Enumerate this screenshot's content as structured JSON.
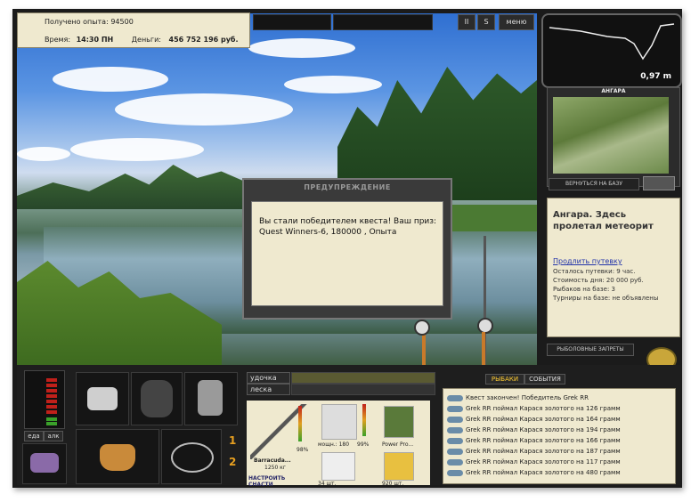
{
  "hud": {
    "exp_label": "Получено опыта:",
    "exp_value": "94500",
    "time_label": "Время:",
    "time_value": "14:30 ПН",
    "money_label": "Деньги:",
    "money_value": "456 752 196 руб."
  },
  "top": {
    "pause": "II",
    "speed": "S",
    "menu": "меню"
  },
  "depth": {
    "value": "0,97 m"
  },
  "map": {
    "title": "АНГАРА",
    "back_button": "ВЕРНУТЬСЯ НА БАЗУ"
  },
  "location": {
    "heading": "Ангара. Здесь пролетал метеорит",
    "extend_link": "Продлить путевку",
    "lines": [
      "Осталось путевки: 9 час.",
      "Стоимость дня: 20 000 руб.",
      "Рыбаков на базе: 3",
      "Турниры на базе: не объявлены"
    ],
    "bans_button": "РЫБОЛОВНЫЕ ЗАПРЕТЫ"
  },
  "dialog": {
    "title": "ПРЕДУПРЕЖДЕНИЕ",
    "message": "Вы стали победителем квеста! Ваш приз: Quest Winners-6, 180000 , Опыта"
  },
  "bottom": {
    "eat_button": "еда",
    "drink_button": "алк",
    "slot1_num": "1",
    "slot2_num": "2",
    "rod_label": "удочка",
    "line_label": "леска",
    "rod_name": "Barracuda...",
    "rod_weight": "1250 кг",
    "rod_percent": "98%",
    "setup_button": "НАСТРОИТЬ СНАСТИ",
    "reel_text": "мощн.: 180",
    "reel_percent": "99%",
    "line_name": "Power Pro...",
    "hook_count": "34 шт.",
    "bait_count": "920 шт."
  },
  "tabs": {
    "fishermen": "РЫБАКИ",
    "events": "СОБЫТИЯ"
  },
  "events": [
    "Квест закончен! Победитель Grek RR",
    "Grek RR поймал Карася золотого на 126 грамм",
    "Grek RR поймал Карася золотого на 164 грамм",
    "Grek RR поймал Карася золотого на 194 грамм",
    "Grek RR поймал Карася золотого на 166 грамм",
    "Grek RR поймал Карася золотого на 187 грамм",
    "Grek RR поймал Карася золотого на 117 грамм",
    "Grek RR поймал Карася золотого на 480 грамм"
  ]
}
